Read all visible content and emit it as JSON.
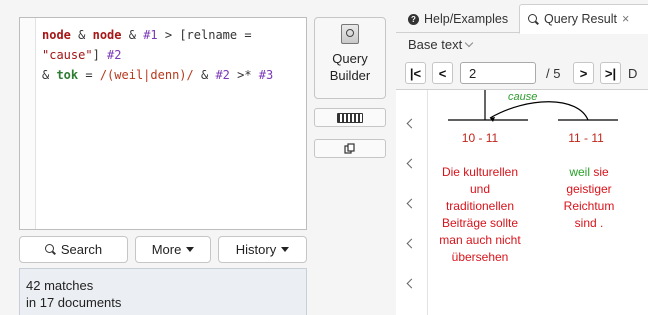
{
  "query": {
    "line1": {
      "kw1": "node",
      "amp1": " & ",
      "kw2": "node",
      "amp2": " & ",
      "var1": "#1",
      "op": " > [relname = ",
      "str": "\"cause\"",
      "end": "] ",
      "var2": "#2"
    },
    "line2": {
      "amp": "& ",
      "kw": "tok",
      "eq": " = ",
      "regex": "/(weil|denn)/",
      "amp2": " & ",
      "var": "#2",
      "op": " >* ",
      "var3": "#3"
    }
  },
  "buttons": {
    "search": "Search",
    "more": "More",
    "history": "History",
    "query_builder": "Query Builder"
  },
  "status": {
    "matches": "42 matches",
    "documents": "in 17 documents"
  },
  "tabs": {
    "help": "Help/Examples",
    "result": "Query Result",
    "result_close": "×"
  },
  "view": {
    "base_text": "Base text"
  },
  "pager": {
    "first": "|<",
    "prev": "<",
    "current": "2",
    "total": "/ 5",
    "next": ">",
    "last": ">|",
    "extra": "D"
  },
  "result": {
    "relation": "cause",
    "range1": "10 - 11",
    "range2": "11 - 11",
    "text1_red": "Die kulturellen und traditionellen Beiträge sollte man auch nicht übersehen",
    "text2_green": "weil",
    "text2_red": "sie geistiger Reichtum sind ."
  },
  "icons": {
    "search": "search-icon",
    "query_builder": "query-builder-icon",
    "keyboard": "keyboard-icon",
    "copy": "copy-icon",
    "info": "info-icon",
    "chevron": "chevron-down-icon"
  },
  "colors": {
    "relation_green": "#2e9a2e",
    "token_red": "#d8141b",
    "token_green": "#2aa02a",
    "keyword": "#a61717"
  }
}
